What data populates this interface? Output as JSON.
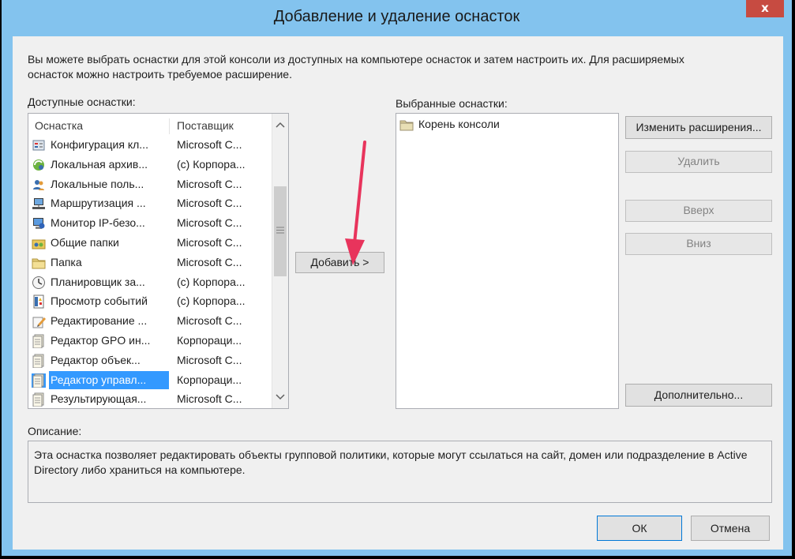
{
  "window": {
    "title": "Добавление и удаление оснасток",
    "close_label": "x"
  },
  "intro_text": "Вы можете выбрать оснастки для этой консоли из доступных на компьютере оснасток и затем настроить их. Для расширяемых оснасток можно настроить требуемое расширение.",
  "available": {
    "label": "Доступные оснастки:",
    "columns": [
      "Оснастка",
      "Поставщик"
    ],
    "rows": [
      {
        "name": "Конфигурация кл...",
        "vendor": "Microsoft C...",
        "icon": "client-config-icon"
      },
      {
        "name": "Локальная архив...",
        "vendor": "(c) Корпора...",
        "icon": "backup-icon"
      },
      {
        "name": "Локальные поль...",
        "vendor": "Microsoft C...",
        "icon": "users-icon"
      },
      {
        "name": "Маршрутизация ...",
        "vendor": "Microsoft C...",
        "icon": "routing-icon"
      },
      {
        "name": "Монитор IP-безо...",
        "vendor": "Microsoft C...",
        "icon": "ipsec-monitor-icon"
      },
      {
        "name": "Общие папки",
        "vendor": "Microsoft C...",
        "icon": "shared-folders-icon"
      },
      {
        "name": "Папка",
        "vendor": "Microsoft C...",
        "icon": "folder-icon"
      },
      {
        "name": "Планировщик за...",
        "vendor": "(c) Корпора...",
        "icon": "scheduler-icon"
      },
      {
        "name": "Просмотр событий",
        "vendor": "(c) Корпора...",
        "icon": "event-viewer-icon"
      },
      {
        "name": "Редактирование ...",
        "vendor": "Microsoft C...",
        "icon": "edit-icon"
      },
      {
        "name": "Редактор GPO ин...",
        "vendor": "Корпораци...",
        "icon": "policy-doc-icon"
      },
      {
        "name": "Редактор объек...",
        "vendor": "Microsoft C...",
        "icon": "policy-doc-icon"
      },
      {
        "name": "Редактор управл...",
        "vendor": "Корпораци...",
        "icon": "policy-doc-icon",
        "selected": true
      },
      {
        "name": "Результирующая...",
        "vendor": "Microsoft C...",
        "icon": "policy-doc-icon"
      }
    ]
  },
  "add_button": "Добавить >",
  "selected": {
    "label": "Выбранные оснастки:",
    "items": [
      {
        "name": "Корень консоли",
        "icon": "folder-icon"
      }
    ]
  },
  "side_buttons": {
    "edit_extensions": "Изменить расширения...",
    "remove": "Удалить",
    "up": "Вверх",
    "down": "Вниз",
    "advanced": "Дополнительно..."
  },
  "description": {
    "label": "Описание:",
    "text": "Эта оснастка позволяет редактировать объекты групповой политики, которые могут ссылаться на сайт, домен или подразделение в Active Directory либо храниться на компьютере."
  },
  "footer": {
    "ok": "ОК",
    "cancel": "Отмена"
  },
  "colors": {
    "titlebar": "#83c3ee",
    "close": "#c74b41",
    "selection": "#3399ff",
    "arrow": "#e8345c"
  }
}
